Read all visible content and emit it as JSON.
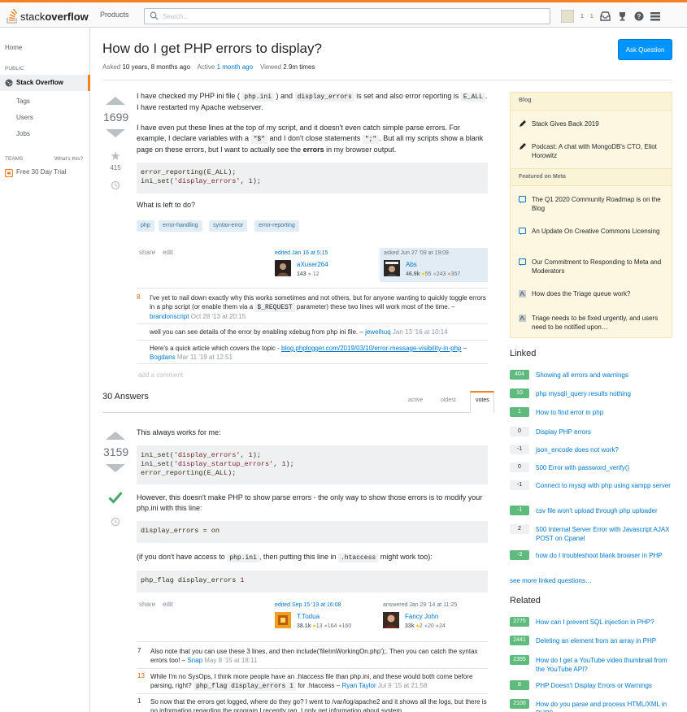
{
  "header": {
    "logo_stack": "stack",
    "logo_overflow": "overflow",
    "products": "Products",
    "search_placeholder": "Search...",
    "rep": "1",
    "badge": "1"
  },
  "leftnav": {
    "home": "Home",
    "public": "PUBLIC",
    "stackoverflow": "Stack Overflow",
    "tags": "Tags",
    "users": "Users",
    "jobs": "Jobs",
    "teams": "TEAMS",
    "whats_this": "What's this?",
    "free_trial": "Free 30 Day Trial"
  },
  "question": {
    "title": "How do I get PHP errors to display?",
    "asked_label": "Asked",
    "asked_value": "10 years, 8 months ago",
    "active_label": "Active",
    "active_value": "1 month ago",
    "viewed_label": "Viewed",
    "viewed_value": "2.9m times",
    "ask_button": "Ask Question",
    "votes": "1699",
    "favorites": "415",
    "p1a": "I have checked my PHP ini file (",
    "p1_code1": "php.ini",
    "p1b": ") and",
    "p1_code2": "display_errors",
    "p1c": "is set and also error reporting is",
    "p1_code3": "E_ALL",
    "p1d": ". I have restarted my Apache webserver.",
    "p2a": "I have even put these lines at the top of my script, and it doesn't even catch simple parse errors. For example, I declare variables with a",
    "p2_code1": "\"$\"",
    "p2b": "and I don't close statements",
    "p2_code2": "\";\"",
    "p2c": ". But all my scripts show a blank page on these errors, but I want to actually see the",
    "p2_bold": "errors",
    "p2d": "in my browser output.",
    "code_l1": "error_reporting(E_ALL);",
    "code_l2a": "ini_set(",
    "code_l2s": "'display_errors'",
    "code_l2b": ", ",
    "code_l2n": "1",
    "code_l2c": ");",
    "p3": "What is left to do?",
    "tags": [
      "php",
      "error-handling",
      "syntax-error",
      "error-reporting"
    ],
    "share": "share",
    "edit": "edit",
    "editor_action": "edited Jan 16 at 5:15",
    "editor_name": "aXuser264",
    "editor_rep": "143",
    "editor_bronze": "12",
    "asker_action": "asked Jun 27 '09 at 19:09",
    "asker_name": "Abs",
    "asker_rep": "46.9k",
    "asker_gold": "55",
    "asker_silver": "243",
    "asker_bronze": "357"
  },
  "qcomments": [
    {
      "score": "8",
      "text": "I've yet to nail down exactly why this works sometimes and not others, but for anyone wanting to quickly toggle errors in a php script (or enable them via a",
      "code": "$_REQUEST",
      "text2": "parameter) these two lines will work most of the time. –",
      "user": "brandonscript",
      "date": "Oct 28 '13 at 20:15"
    },
    {
      "score": "",
      "text": "well you can see details of the error by enabling xdebug from php ini file. –",
      "user": "jewelhuq",
      "date": "Jan 13 '16 at 10:14"
    },
    {
      "score": "",
      "text": "Here's a quick article which covers the topic -",
      "link": "blog.phplogger.com/2019/03/10/error-message-visibility-in-php",
      "text2": "–",
      "user": "Bogdans",
      "date": "Mar 11 '19 at 12:51"
    }
  ],
  "add_comment": "add a comment",
  "answers_header": {
    "count": "30 Answers",
    "tab_active": "active",
    "tab_oldest": "oldest",
    "tab_votes": "votes"
  },
  "answer": {
    "votes": "3159",
    "p1": "This always works for me:",
    "c1_l1a": "ini_set(",
    "c1_l1s": "'display_errors'",
    "c1_l1b": ", ",
    "c1_l1n": "1",
    "c1_l1c": ");",
    "c1_l2a": "ini_set(",
    "c1_l2s": "'display_startup_errors'",
    "c1_l2b": ", ",
    "c1_l2n": "1",
    "c1_l2c": ");",
    "c1_l3": "error_reporting(E_ALL);",
    "p2": "However, this doesn't make PHP to show parse errors - the only way to show those errors is to modify your php.ini with this line:",
    "c2": "display_errors = on",
    "p3a": "(if you don't have access to",
    "p3_code1": "php.ini",
    "p3b": ", then putting this line in",
    "p3_code2": ".htaccess",
    "p3c": "might work too):",
    "c3a": "php_flag display_errors ",
    "c3n": "1",
    "share": "share",
    "edit": "edit",
    "editor_action": "edited Sep 15 '19 at 16:08",
    "editor_name": "T.Todua",
    "editor_rep": "38.1k",
    "editor_gold": "13",
    "editor_silver": "164",
    "editor_bronze": "160",
    "answerer_action": "answered Jan 29 '14 at 11:25",
    "answerer_name": "Fancy John",
    "answerer_rep": "33k",
    "answerer_gold": "2",
    "answerer_silver": "20",
    "answerer_bronze": "24"
  },
  "acomments": [
    {
      "score": "7",
      "text": "Also note that you can use these 3 lines, and then include('fileImWorkingOn.php');. Then you can catch the syntax errors too! –",
      "user": "Snap",
      "date": "May 8 '15 at 18:11"
    },
    {
      "score": "13",
      "text": "While I'm no SysOps, I think more people have an .htaccess file than php.ini, and these would both come before parsing, right?",
      "code": "php_flag display_errors 1",
      "text2": "for .htaccess –",
      "user": "Ryan Taylor",
      "date": "Jul 9 '15 at 21:58"
    },
    {
      "score": "1",
      "text": "So now that the errors get logged, where do they go? I went to /var/log/apache2 and it shows all the logs, but there is no information regarding the program I recently ran. I only get information about system"
    }
  ],
  "sidebar": {
    "blog_header": "Blog",
    "blog": [
      "Stack Gives Back 2019",
      "Podcast: A chat with MongoDB's CTO, Eliot Horowitz"
    ],
    "meta_header": "Featured on Meta",
    "meta": [
      "The Q1 2020 Community Roadmap is on the Blog",
      "An Update On Creative Commons Licensing",
      "Our Commitment to Responding to Meta and Moderators",
      "How does the Triage queue work?",
      "Triage needs to be fixed urgently, and users need to be notified upon…"
    ]
  },
  "linked": {
    "header": "Linked",
    "items": [
      {
        "score": "404",
        "text": "Showing all errors and warnings"
      },
      {
        "score": "10",
        "text": "php mysqli_query results nothing"
      },
      {
        "score": "1",
        "text": "How to find error in php"
      },
      {
        "score": "0",
        "text": "Display PHP errors"
      },
      {
        "score": "-1",
        "text": "json_encode does not work?"
      },
      {
        "score": "0",
        "text": "500 Error with password_verify()"
      },
      {
        "score": "-1",
        "text": "Connect to mysql with php using xampp server"
      },
      {
        "score": "-1",
        "text": "csv file won't upload through php uploader"
      },
      {
        "score": "2",
        "text": "500 Internal Server Error with Javascript AJAX POST on Cpanel"
      },
      {
        "score": "-3",
        "text": "how do I troubleshoot blank browser in PHP"
      }
    ],
    "more": "see more linked questions…"
  },
  "related": {
    "header": "Related",
    "items": [
      {
        "score": "2775",
        "text": "How can I prevent SQL injection in PHP?"
      },
      {
        "score": "2441",
        "text": "Deleting an element from an array in PHP"
      },
      {
        "score": "2355",
        "text": "How do I get a YouTube video thumbnail from the YouTube API?"
      },
      {
        "score": "8",
        "text": "PHP Doesn't Display Errors or Warnings"
      },
      {
        "score": "2100",
        "text": "How do you parse and process HTML/XML in PHP?"
      }
    ]
  },
  "colors": {
    "accent": "#f48024",
    "link": "#0077cc",
    "accepted": "#48a868"
  }
}
